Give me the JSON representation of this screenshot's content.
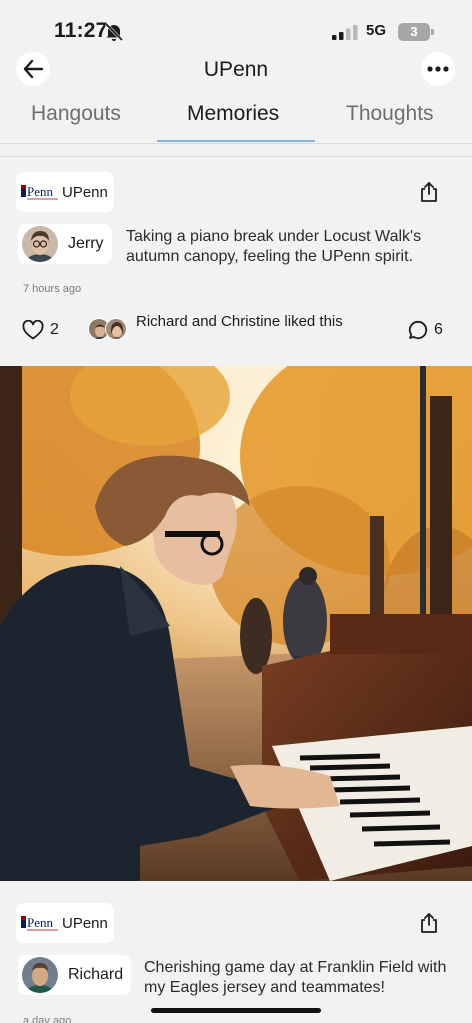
{
  "status_bar": {
    "time": "11:27",
    "network": "5G",
    "battery_level": "3"
  },
  "header": {
    "title": "UPenn"
  },
  "tabs": [
    {
      "label": "Hangouts"
    },
    {
      "label": "Memories",
      "active": true
    },
    {
      "label": "Thoughts"
    }
  ],
  "posts": [
    {
      "community": "UPenn",
      "author": "Jerry",
      "text": "Taking a piano break under Locust Walk's autumn canopy, feeling the UPenn spirit.",
      "timestamp": "7 hours ago",
      "likes": "2",
      "liked_by": "Richard and Christine liked this",
      "comments": "6"
    },
    {
      "community": "UPenn",
      "author": "Richard",
      "text": "Cherishing game day at Franklin Field with my Eagles jersey and teammates!",
      "timestamp": "a day ago"
    }
  ],
  "colors": {
    "accent": "#8ab3e6",
    "background": "#f2f2f3",
    "penn_blue": "#011f5b",
    "penn_red": "#990000"
  }
}
